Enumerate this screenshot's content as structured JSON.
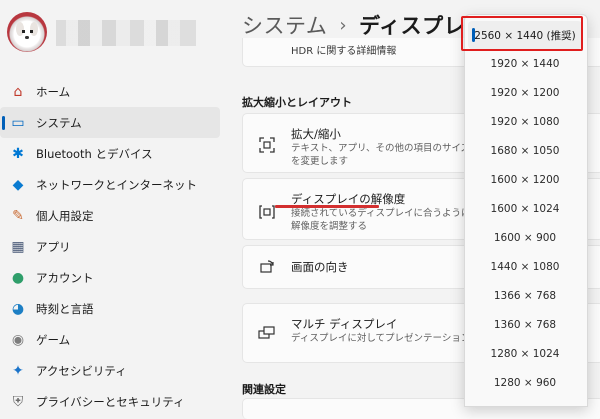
{
  "breadcrumb": {
    "root": "システム",
    "separator": "›",
    "current": "ディスプレイ"
  },
  "sidebar": {
    "items": [
      {
        "label": "ホーム",
        "icon": "home-icon",
        "glyph": "⌂",
        "color": "#c0392b"
      },
      {
        "label": "システム",
        "icon": "system-monitor-icon",
        "glyph": "▭",
        "color": "#0067c0",
        "active": true
      },
      {
        "label": "Bluetooth とデバイス",
        "icon": "bluetooth-icon",
        "glyph": "✱",
        "color": "#0078d4"
      },
      {
        "label": "ネットワークとインターネット",
        "icon": "wifi-icon",
        "glyph": "◆",
        "color": "#0a7bd1"
      },
      {
        "label": "個人用設定",
        "icon": "paintbrush-icon",
        "glyph": "✎",
        "color": "#c96b34"
      },
      {
        "label": "アプリ",
        "icon": "apps-icon",
        "glyph": "▦",
        "color": "#4a5a78"
      },
      {
        "label": "アカウント",
        "icon": "account-icon",
        "glyph": "●",
        "color": "#2f9e6a"
      },
      {
        "label": "時刻と言語",
        "icon": "globe-clock-icon",
        "glyph": "◕",
        "color": "#1d7fc4"
      },
      {
        "label": "ゲーム",
        "icon": "gamepad-icon",
        "glyph": "◉",
        "color": "#7d7d7d"
      },
      {
        "label": "アクセシビリティ",
        "icon": "accessibility-icon",
        "glyph": "✦",
        "color": "#1a73c9"
      },
      {
        "label": "プライバシーとセキュリティ",
        "icon": "shield-icon",
        "glyph": "⛨",
        "color": "#6b6b6b"
      }
    ]
  },
  "main": {
    "top_card_text": "HDR に関する詳細情報",
    "section_scale_layout": "拡大縮小とレイアウト",
    "cards": [
      {
        "title": "拡大/縮小",
        "desc": "テキスト、アプリ、その他の項目のサイズを変更します",
        "icon": "zoom-icon"
      },
      {
        "title": "ディスプレイの解像度",
        "desc": "接続されているディスプレイに合うように解像度を調整する",
        "icon": "resolution-icon"
      },
      {
        "title": "画面の向き",
        "desc": "",
        "icon": "rotate-icon"
      },
      {
        "title": "マルチ ディスプレイ",
        "desc": "ディスプレイに対してプレゼンテーション モードを選択",
        "icon": "multi-display-icon"
      }
    ],
    "section_related": "関連設定"
  },
  "resolution_dropdown": {
    "selected": "2560 × 1440 (推奨)",
    "options": [
      "2560 × 1440 (推奨)",
      "1920 × 1440",
      "1920 × 1200",
      "1920 × 1080",
      "1680 × 1050",
      "1600 × 1200",
      "1600 × 1024",
      "1600 × 900",
      "1440 × 1080",
      "1366 × 768",
      "1360 × 768",
      "1280 × 1024",
      "1280 × 960"
    ]
  },
  "colors": {
    "accent": "#005fb8",
    "highlight": "#e01e1e"
  }
}
